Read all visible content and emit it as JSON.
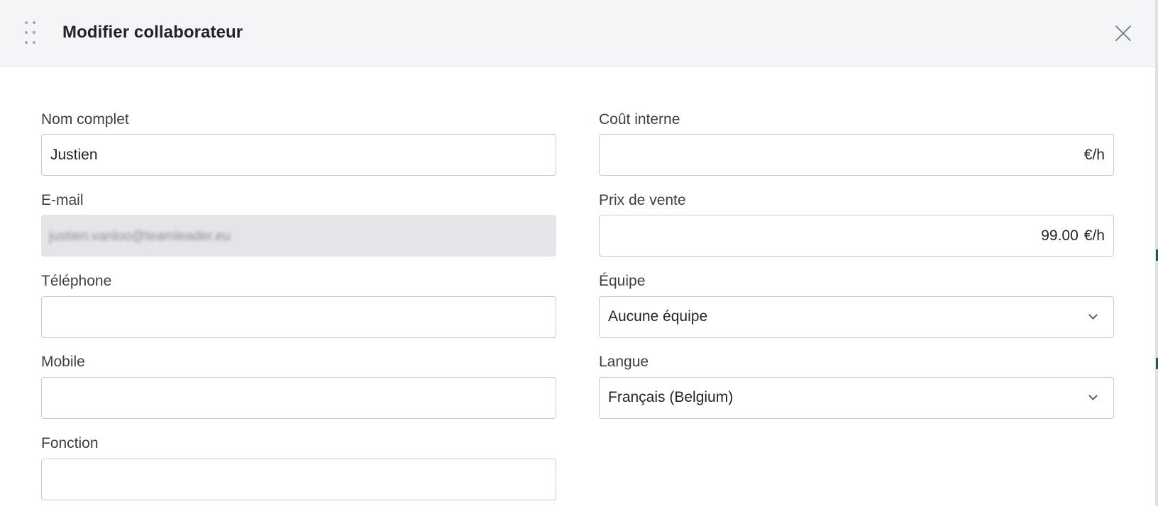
{
  "modal": {
    "title": "Modifier collaborateur",
    "drag_icon": "drag-handle-icon",
    "close_icon": "close-icon"
  },
  "form": {
    "full_name": {
      "label": "Nom complet",
      "value": "Justien"
    },
    "email": {
      "label": "E-mail",
      "value": "justien.vanloo@teamleader.eu"
    },
    "phone": {
      "label": "Téléphone",
      "value": ""
    },
    "mobile": {
      "label": "Mobile",
      "value": ""
    },
    "function": {
      "label": "Fonction",
      "value": ""
    },
    "internal_cost": {
      "label": "Coût interne",
      "value": "",
      "unit": "€/h"
    },
    "sale_price": {
      "label": "Prix de vente",
      "value": "99.00",
      "unit": "€/h"
    },
    "team": {
      "label": "Équipe",
      "selected": "Aucune équipe"
    },
    "language": {
      "label": "Langue",
      "selected": "Français (Belgium)"
    }
  },
  "colors": {
    "header_bg": "#f4f5f7",
    "border": "#c7cbd1",
    "disabled_bg": "#e4e5e8",
    "accent_teal": "#0e5e66"
  }
}
